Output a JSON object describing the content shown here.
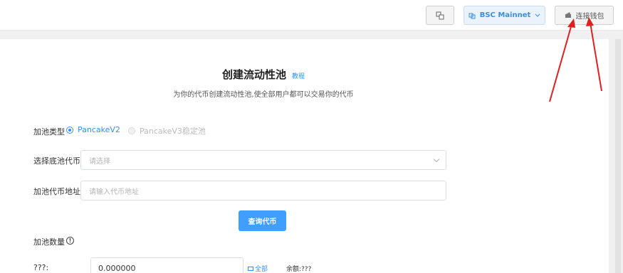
{
  "header": {
    "language_icon": "language-translate-icon",
    "network_label": "BSC Mainnet",
    "wallet_label": "连接钱包"
  },
  "page": {
    "title": "创建流动性池",
    "tutorial_link": "教程",
    "subtitle": "为你的代币创建流动性池,使全部用户都可以交易你的代币"
  },
  "form": {
    "pool_type_label": "加池类型",
    "pool_type_options": [
      "PancakeV2",
      "PancakeV3稳定池"
    ],
    "base_token_label": "选择底池代币",
    "base_token_placeholder": "请选择",
    "token_address_label": "加池代币地址",
    "token_address_placeholder": "请输入代币地址",
    "query_button": "查询代币",
    "amount_label": "加池数量",
    "amount_row_label": "???:",
    "amount_value": "0.000000",
    "all_link": "全部",
    "balance_text": "余额:???"
  },
  "colors": {
    "accent": "#409eff",
    "annotation_arrow": "#e02020"
  }
}
